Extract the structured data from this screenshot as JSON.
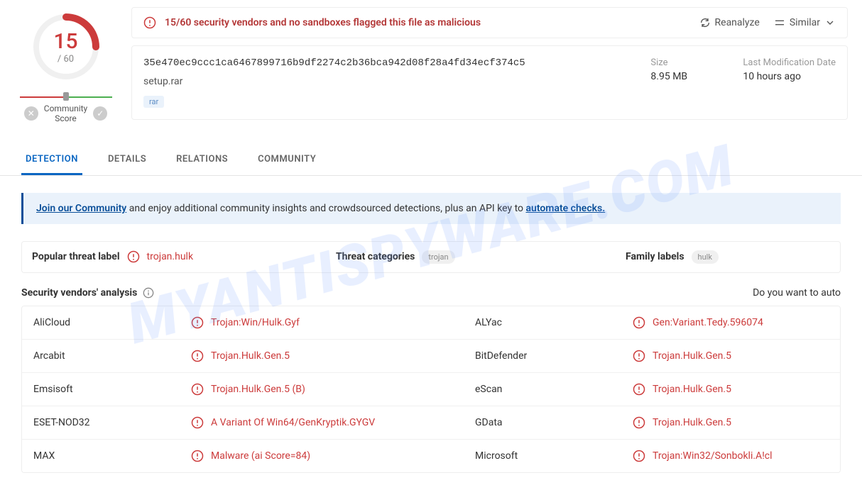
{
  "score": {
    "detected": "15",
    "total": "/ 60"
  },
  "community": {
    "label": "Community\nScore"
  },
  "alert": {
    "text": "15/60 security vendors and no sandboxes flagged this file as malicious"
  },
  "actions": {
    "reanalyze": "Reanalyze",
    "similar": "Similar"
  },
  "file": {
    "hash": "35e470ec9ccc1ca6467899716b9df2274c2b36bca942d08f28a4fd34ecf374c5",
    "name": "setup.rar",
    "tag": "rar"
  },
  "meta": {
    "size_label": "Size",
    "size_val": "8.95 MB",
    "date_label": "Last Modification Date",
    "date_val": "10 hours ago"
  },
  "tabs": {
    "detection": "DETECTION",
    "details": "DETAILS",
    "relations": "RELATIONS",
    "community": "COMMUNITY"
  },
  "banner": {
    "link1": "Join our Community",
    "middle": " and enjoy additional community insights and crowdsourced detections, plus an API key to ",
    "link2": "automate checks."
  },
  "labels": {
    "popular_title": "Popular threat label",
    "popular_val": "trojan.hulk",
    "cat_title": "Threat categories",
    "cat_val": "trojan",
    "fam_title": "Family labels",
    "fam_val": "hulk"
  },
  "section": {
    "title": "Security vendors' analysis",
    "right_text": "Do you want to auto"
  },
  "vendors": [
    {
      "l_name": "AliCloud",
      "l_det": "Trojan:Win/Hulk.Gyf",
      "r_name": "ALYac",
      "r_det": "Gen:Variant.Tedy.596074"
    },
    {
      "l_name": "Arcabit",
      "l_det": "Trojan.Hulk.Gen.5",
      "r_name": "BitDefender",
      "r_det": "Trojan.Hulk.Gen.5"
    },
    {
      "l_name": "Emsisoft",
      "l_det": "Trojan.Hulk.Gen.5 (B)",
      "r_name": "eScan",
      "r_det": "Trojan.Hulk.Gen.5"
    },
    {
      "l_name": "ESET-NOD32",
      "l_det": "A Variant Of Win64/GenKryptik.GYGV",
      "r_name": "GData",
      "r_det": "Trojan.Hulk.Gen.5"
    },
    {
      "l_name": "MAX",
      "l_det": "Malware (ai Score=84)",
      "r_name": "Microsoft",
      "r_det": "Trojan:Win32/Sonbokli.A!cl"
    }
  ]
}
